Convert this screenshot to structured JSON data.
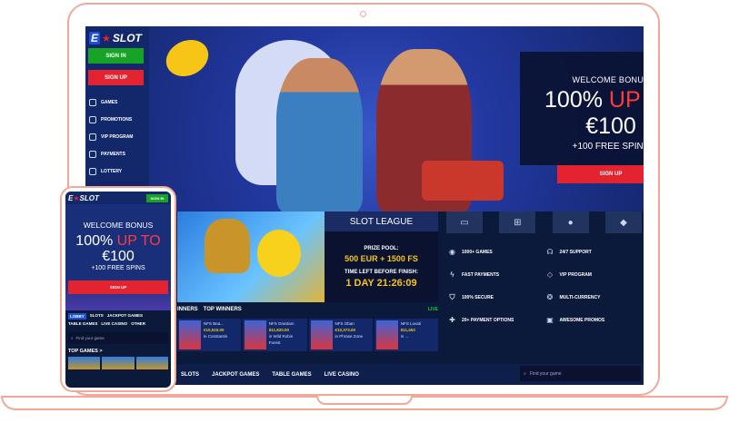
{
  "brand": {
    "logo_e": "E",
    "logo_text": "SLOT"
  },
  "sidebar": {
    "signin_label": "SIGN IN",
    "signup_label": "SIGN UP",
    "items": [
      {
        "label": "GAMES",
        "icon": "games-icon"
      },
      {
        "label": "PROMOTIONS",
        "icon": "gift-icon"
      },
      {
        "label": "VIP PROGRAM",
        "icon": "diamond-icon"
      },
      {
        "label": "PAYMENTS",
        "icon": "wallet-icon"
      },
      {
        "label": "LOTTERY",
        "icon": "ticket-icon"
      }
    ]
  },
  "hero": {
    "welcome_title": "WELCOME BONUS",
    "amount_prefix": "100%",
    "amount_highlight": "UP TO",
    "amount_value": "€100",
    "spins": "+100 FREE SPINS",
    "signup_label": "SIGN UP"
  },
  "league": {
    "title": "SLOT LEAGUE",
    "prize_label": "PRIZE POOL:",
    "prize_value": "500 EUR + 1500 FS",
    "time_label": "TIME LEFT BEFORE FINISH:",
    "time_value": "1 DAY 21:26:09"
  },
  "winners": {
    "tab_partial": "INNERS",
    "tab_active": "TOP WINNERS",
    "live_label": "LIVE",
    "items": [
      {
        "name": "NFS Bea...",
        "amount": "€10,515.00",
        "game": "in Constantin"
      },
      {
        "name": "NFS Grantam",
        "amount": "$11,820.00",
        "game": "in Wild Robin Forest"
      },
      {
        "name": "NFS Oban",
        "amount": "€10,373.00",
        "game": "in Phrase Zone"
      },
      {
        "name": "NFS Lovati",
        "amount": "$11,453",
        "game": "in ..."
      }
    ]
  },
  "platforms": [
    "desktop-icon",
    "windows-icon",
    "apple-icon",
    "android-icon"
  ],
  "features": [
    {
      "label": "1000+ GAMES",
      "icon": "games-icon"
    },
    {
      "label": "24/7 SUPPORT",
      "icon": "headset-icon"
    },
    {
      "label": "FAST PAYMENTS",
      "icon": "bolt-icon"
    },
    {
      "label": "VIP PROGRAM",
      "icon": "diamond-icon"
    },
    {
      "label": "100% SECURE",
      "icon": "shield-icon"
    },
    {
      "label": "MULTI-CURRENCY",
      "icon": "coins-icon"
    },
    {
      "label": "20+ PAYMENT OPTIONS",
      "icon": "plus-icon"
    },
    {
      "label": "AWESOME PROMOS",
      "icon": "gift-icon"
    }
  ],
  "bottom_nav": [
    "SLOTS",
    "JACKPOT GAMES",
    "TABLE GAMES",
    "LIVE CASINO"
  ],
  "search": {
    "placeholder": "Find your game"
  },
  "phone": {
    "signin_label": "SIGN IN",
    "welcome_title": "WELCOME BONUS",
    "amount_prefix": "100%",
    "amount_highlight": "UP TO",
    "amount_value": "€100",
    "spins": "+100 FREE SPINS",
    "signup_label": "SIGN UP",
    "tabs": [
      "LOBBY",
      "SLOTS",
      "JACKPOT GAMES",
      "TABLE GAMES",
      "LIVE CASINO",
      "OTHER"
    ],
    "search_placeholder": "Find your game",
    "top_games": "TOP GAMES >"
  }
}
